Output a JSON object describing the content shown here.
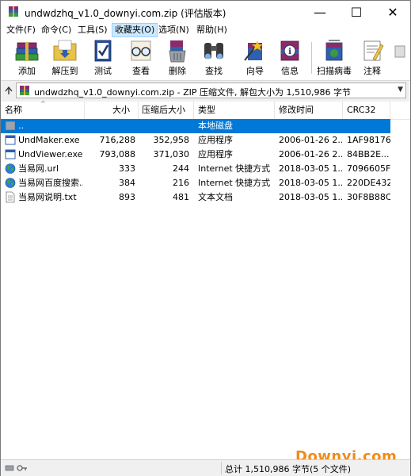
{
  "window": {
    "title": "undwdzhq_v1.0_downyi.com.zip (评估版本)",
    "controls": {
      "minimize": "—",
      "maximize": "☐",
      "close": "✕"
    }
  },
  "menu": [
    {
      "label": "文件(F)"
    },
    {
      "label": "命令(C)"
    },
    {
      "label": "工具(S)"
    },
    {
      "label": "收藏夹(O)",
      "active": true
    },
    {
      "label": "选项(N)"
    },
    {
      "label": "帮助(H)"
    }
  ],
  "toolbar": [
    {
      "label": "添加",
      "icon": "books-add-icon"
    },
    {
      "label": "解压到",
      "icon": "folder-extract-icon"
    },
    {
      "label": "测试",
      "icon": "checklist-icon"
    },
    {
      "label": "查看",
      "icon": "glasses-icon"
    },
    {
      "label": "删除",
      "icon": "trash-icon"
    },
    {
      "label": "查找",
      "icon": "binoculars-icon"
    },
    {
      "label": "向导",
      "icon": "wizard-icon"
    },
    {
      "label": "信息",
      "icon": "info-icon"
    },
    {
      "label": "扫描病毒",
      "icon": "scan-virus-icon"
    },
    {
      "label": "注释",
      "icon": "comment-icon"
    }
  ],
  "address": {
    "text": "undwdzhq_v1.0_downyi.com.zip - ZIP 压缩文件, 解包大小为 1,510,986 字节"
  },
  "columns": {
    "name": "名称",
    "size": "大小",
    "packed": "压缩后大小",
    "type": "类型",
    "modified": "修改时间",
    "crc": "CRC32"
  },
  "files": [
    {
      "name": "..",
      "size": "",
      "packed": "",
      "type": "本地磁盘",
      "modified": "",
      "crc": "",
      "icon": "parent-folder-icon",
      "selected": true
    },
    {
      "name": "UndMaker.exe",
      "size": "716,288",
      "packed": "352,958",
      "type": "应用程序",
      "modified": "2006-01-26 2...",
      "crc": "1AF98176",
      "icon": "exe-file-icon"
    },
    {
      "name": "UndViewer.exe",
      "size": "793,088",
      "packed": "371,030",
      "type": "应用程序",
      "modified": "2006-01-26 2...",
      "crc": "84BB2E...",
      "icon": "exe-file-icon"
    },
    {
      "name": "当易网.url",
      "size": "333",
      "packed": "244",
      "type": "Internet 快捷方式",
      "modified": "2018-03-05 1...",
      "crc": "7096605F",
      "icon": "globe-icon"
    },
    {
      "name": "当易网百度搜索...",
      "size": "384",
      "packed": "216",
      "type": "Internet 快捷方式",
      "modified": "2018-03-05 1...",
      "crc": "220DE432",
      "icon": "globe-icon"
    },
    {
      "name": "当易网说明.txt",
      "size": "893",
      "packed": "481",
      "type": "文本文档",
      "modified": "2018-03-05 1...",
      "crc": "30F8B88C",
      "icon": "text-file-icon"
    }
  ],
  "status": {
    "text": "总计 1,510,986 字节(5 个文件)"
  },
  "watermark": "Downyi.com",
  "colors": {
    "selection": "#0078d7",
    "menu_active": "#cce8ff",
    "watermark": "#f08c1c"
  }
}
